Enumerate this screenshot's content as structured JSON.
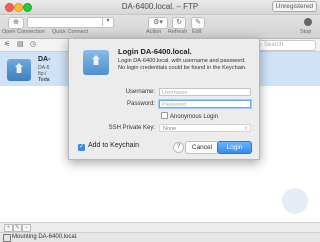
{
  "window": {
    "title": "DA-6400.local. – FTP",
    "unregistered_label": "Unregistered"
  },
  "toolbar": {
    "open_connection": "Open Connection",
    "quick_connect": "Quick Connect",
    "action": "Action",
    "refresh": "Refresh",
    "edit": "Edit",
    "stop": "Stop"
  },
  "search": {
    "placeholder": "Search"
  },
  "list": {
    "item": {
      "title": "DA-",
      "sub1": "DA-6",
      "sub2": "ftp:/",
      "sub3": "Toda"
    }
  },
  "modal": {
    "title": "Login DA-6400.local.",
    "message": "Login DA-6400.local. with username and password. No login credentials could be found in the Keychain.",
    "username_label": "Username:",
    "username_placeholder": "Username",
    "password_label": "Password:",
    "password_placeholder": "Password",
    "anonymous_label": "Anonymous Login",
    "ssh_label": "SSH Private Key:",
    "ssh_value": "None",
    "keychain_label": "Add to Keychain",
    "help_label": "?",
    "cancel_label": "Cancel",
    "login_label": "Login"
  },
  "status": {
    "text": "Mounting DA-6400.local."
  },
  "colors": {
    "accent": "#3d88e6",
    "selection": "#cfe2f6"
  }
}
